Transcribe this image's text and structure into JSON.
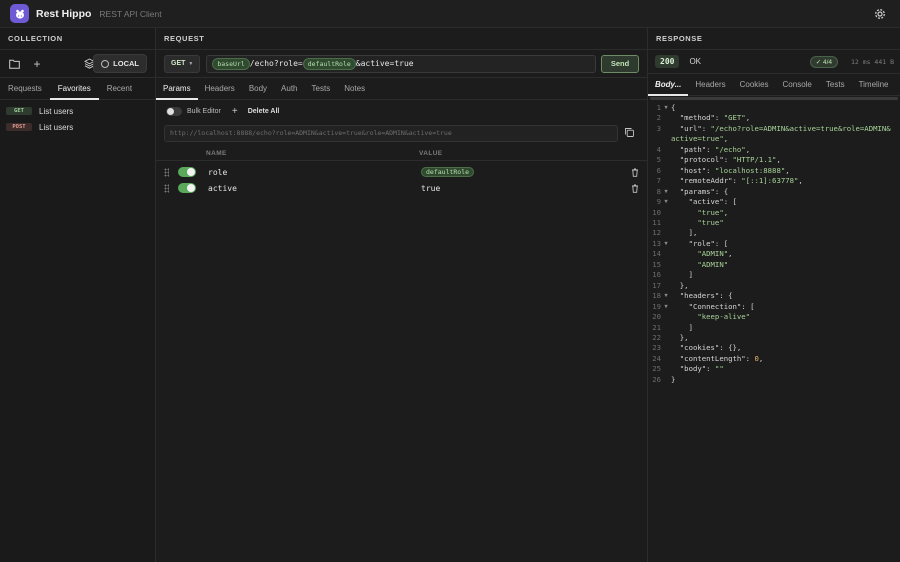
{
  "app": {
    "name": "Rest Hippo",
    "subtitle": "REST API Client"
  },
  "collection": {
    "title": "COLLECTION",
    "env_label": "LOCAL",
    "tabs": [
      {
        "label": "Requests"
      },
      {
        "label": "Favorites"
      },
      {
        "label": "Recent"
      }
    ],
    "active_tab": 1,
    "favorites": [
      {
        "method": "GET",
        "name": "List users"
      },
      {
        "method": "POST",
        "name": "List users"
      }
    ]
  },
  "request": {
    "title": "REQUEST",
    "method": "GET",
    "url_var": "baseUrl",
    "url_path": "/echo?role=",
    "url_var2": "defaultRole",
    "url_tail": "&active=true",
    "send_label": "Send",
    "tabs": [
      {
        "label": "Params"
      },
      {
        "label": "Headers"
      },
      {
        "label": "Body"
      },
      {
        "label": "Auth"
      },
      {
        "label": "Tests"
      },
      {
        "label": "Notes"
      }
    ],
    "bulk_editor_label": "Bulk Editor",
    "delete_all_label": "Delete All",
    "resolved_url": "http://localhost:8888/echo?role=ADMIN&active=true&role=ADMIN&active=true",
    "columns": {
      "name": "NAME",
      "value": "VALUE"
    },
    "params": [
      {
        "name": "role",
        "value": "defaultRole",
        "is_var": true,
        "enabled": true
      },
      {
        "name": "active",
        "value": "true",
        "is_var": false,
        "enabled": true
      }
    ]
  },
  "response": {
    "title": "RESPONSE",
    "status_code": "200",
    "status_text": "OK",
    "tests": "✓ 4/4",
    "timing": "12 ms  441 B",
    "tabs": [
      {
        "label": "Body..."
      },
      {
        "label": "Headers"
      },
      {
        "label": "Cookies"
      },
      {
        "label": "Console"
      },
      {
        "label": "Tests"
      },
      {
        "label": "Timeline"
      }
    ],
    "body_lines": [
      {
        "n": "1",
        "f": "▼",
        "parts": [
          {
            "t": "{",
            "c": "txt"
          }
        ]
      },
      {
        "n": "2",
        "f": "",
        "parts": [
          {
            "t": "  \"method\": ",
            "c": "txt"
          },
          {
            "t": "\"GET\"",
            "c": "s"
          },
          {
            "t": ",",
            "c": "txt"
          }
        ]
      },
      {
        "n": "3",
        "f": "",
        "parts": [
          {
            "t": "  \"url\": ",
            "c": "txt"
          },
          {
            "t": "\"/echo?role=ADMIN&active=true&role=ADMIN&",
            "c": "s"
          }
        ]
      },
      {
        "n": "",
        "f": "",
        "parts": [
          {
            "t": "active=true\"",
            "c": "s"
          },
          {
            "t": ",",
            "c": "txt"
          }
        ]
      },
      {
        "n": "4",
        "f": "",
        "parts": [
          {
            "t": "  \"path\": ",
            "c": "txt"
          },
          {
            "t": "\"/echo\"",
            "c": "s"
          },
          {
            "t": ",",
            "c": "txt"
          }
        ]
      },
      {
        "n": "5",
        "f": "",
        "parts": [
          {
            "t": "  \"protocol\": ",
            "c": "txt"
          },
          {
            "t": "\"HTTP/1.1\"",
            "c": "s"
          },
          {
            "t": ",",
            "c": "txt"
          }
        ]
      },
      {
        "n": "6",
        "f": "",
        "parts": [
          {
            "t": "  \"host\": ",
            "c": "txt"
          },
          {
            "t": "\"localhost:8888\"",
            "c": "s"
          },
          {
            "t": ",",
            "c": "txt"
          }
        ]
      },
      {
        "n": "7",
        "f": "",
        "parts": [
          {
            "t": "  \"remoteAddr\": ",
            "c": "txt"
          },
          {
            "t": "\"[::1]:63778\"",
            "c": "s"
          },
          {
            "t": ",",
            "c": "txt"
          }
        ]
      },
      {
        "n": "8",
        "f": "▼",
        "parts": [
          {
            "t": "  \"params\": {",
            "c": "txt"
          }
        ]
      },
      {
        "n": "9",
        "f": "▼",
        "parts": [
          {
            "t": "    \"active\": [",
            "c": "txt"
          }
        ]
      },
      {
        "n": "10",
        "f": "",
        "parts": [
          {
            "t": "      ",
            "c": "txt"
          },
          {
            "t": "\"true\"",
            "c": "s"
          },
          {
            "t": ",",
            "c": "txt"
          }
        ]
      },
      {
        "n": "11",
        "f": "",
        "parts": [
          {
            "t": "      ",
            "c": "txt"
          },
          {
            "t": "\"true\"",
            "c": "s"
          }
        ]
      },
      {
        "n": "12",
        "f": "",
        "parts": [
          {
            "t": "    ],",
            "c": "txt"
          }
        ]
      },
      {
        "n": "13",
        "f": "▼",
        "parts": [
          {
            "t": "    \"role\": [",
            "c": "txt"
          }
        ]
      },
      {
        "n": "14",
        "f": "",
        "parts": [
          {
            "t": "      ",
            "c": "txt"
          },
          {
            "t": "\"ADMIN\"",
            "c": "s"
          },
          {
            "t": ",",
            "c": "txt"
          }
        ]
      },
      {
        "n": "15",
        "f": "",
        "parts": [
          {
            "t": "      ",
            "c": "txt"
          },
          {
            "t": "\"ADMIN\"",
            "c": "s"
          }
        ]
      },
      {
        "n": "16",
        "f": "",
        "parts": [
          {
            "t": "    ]",
            "c": "txt"
          }
        ]
      },
      {
        "n": "17",
        "f": "",
        "parts": [
          {
            "t": "  },",
            "c": "txt"
          }
        ]
      },
      {
        "n": "18",
        "f": "▼",
        "parts": [
          {
            "t": "  \"headers\": {",
            "c": "txt"
          }
        ]
      },
      {
        "n": "19",
        "f": "▼",
        "parts": [
          {
            "t": "    \"Connection\": [",
            "c": "txt"
          }
        ]
      },
      {
        "n": "20",
        "f": "",
        "parts": [
          {
            "t": "      ",
            "c": "txt"
          },
          {
            "t": "\"keep-alive\"",
            "c": "s"
          }
        ]
      },
      {
        "n": "21",
        "f": "",
        "parts": [
          {
            "t": "    ]",
            "c": "txt"
          }
        ]
      },
      {
        "n": "22",
        "f": "",
        "parts": [
          {
            "t": "  },",
            "c": "txt"
          }
        ]
      },
      {
        "n": "23",
        "f": "",
        "parts": [
          {
            "t": "  \"cookies\": {},",
            "c": "txt"
          }
        ]
      },
      {
        "n": "24",
        "f": "",
        "parts": [
          {
            "t": "  \"contentLength\": ",
            "c": "txt"
          },
          {
            "t": "0",
            "c": "n"
          },
          {
            "t": ",",
            "c": "txt"
          }
        ]
      },
      {
        "n": "25",
        "f": "",
        "parts": [
          {
            "t": "  \"body\": ",
            "c": "txt"
          },
          {
            "t": "\"\"",
            "c": "s"
          }
        ]
      },
      {
        "n": "26",
        "f": "",
        "parts": [
          {
            "t": "}",
            "c": "txt"
          }
        ]
      }
    ]
  }
}
